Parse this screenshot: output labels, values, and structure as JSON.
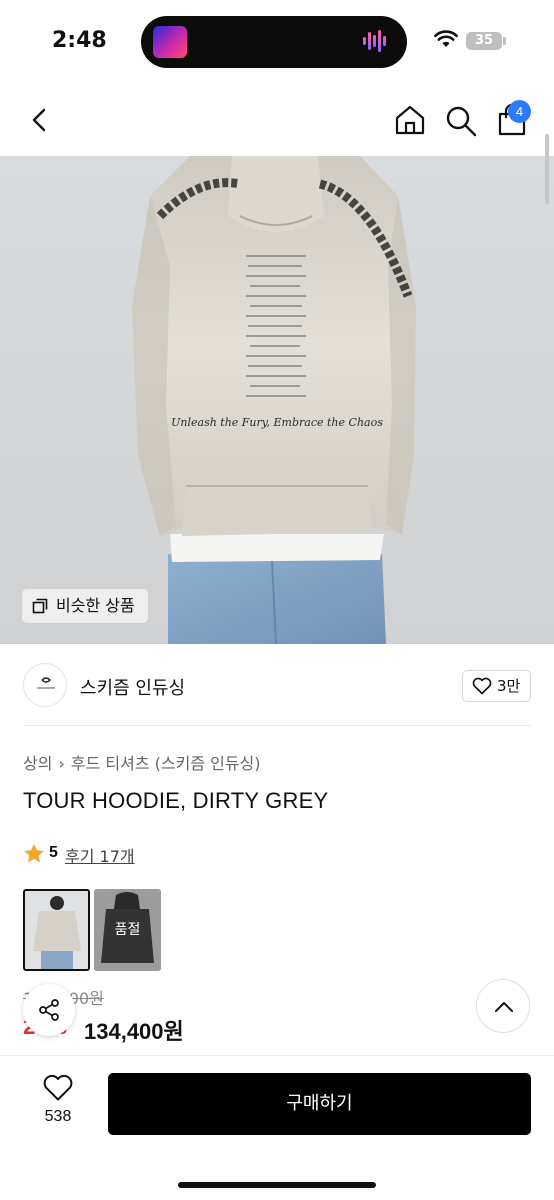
{
  "status_bar": {
    "time": "2:48",
    "battery": "35"
  },
  "nav": {
    "icons": [
      "back-icon",
      "home-icon",
      "search-icon",
      "shopping-bag-icon"
    ],
    "cart_count": "4"
  },
  "hero": {
    "image_text": "Unleash the Fury, Embrace the Chaos",
    "similar_button": "비슷한 상품"
  },
  "brand": {
    "name": "스키즘 인듀싱",
    "likes": "3만"
  },
  "product": {
    "breadcrumb": [
      "상의",
      "후드 티셔츠 (스키즘 인듀싱)"
    ],
    "title": "TOUR HOODIE, DIRTY GREY",
    "rating": "5",
    "reviews": "후기 17개",
    "variants": [
      {
        "color": "dirty grey",
        "selected": true
      },
      {
        "color": "black",
        "label": "품절"
      }
    ],
    "original_price": "168,000원",
    "discount": "20%",
    "price": "134,400원"
  },
  "bottom_bar": {
    "wish_count": "538",
    "buy_label": "구매하기"
  },
  "colors": {
    "accent_badge": "#2f7bff",
    "discount": "#e5302b",
    "star": "#f4a62a",
    "buy_button": "#000000"
  }
}
